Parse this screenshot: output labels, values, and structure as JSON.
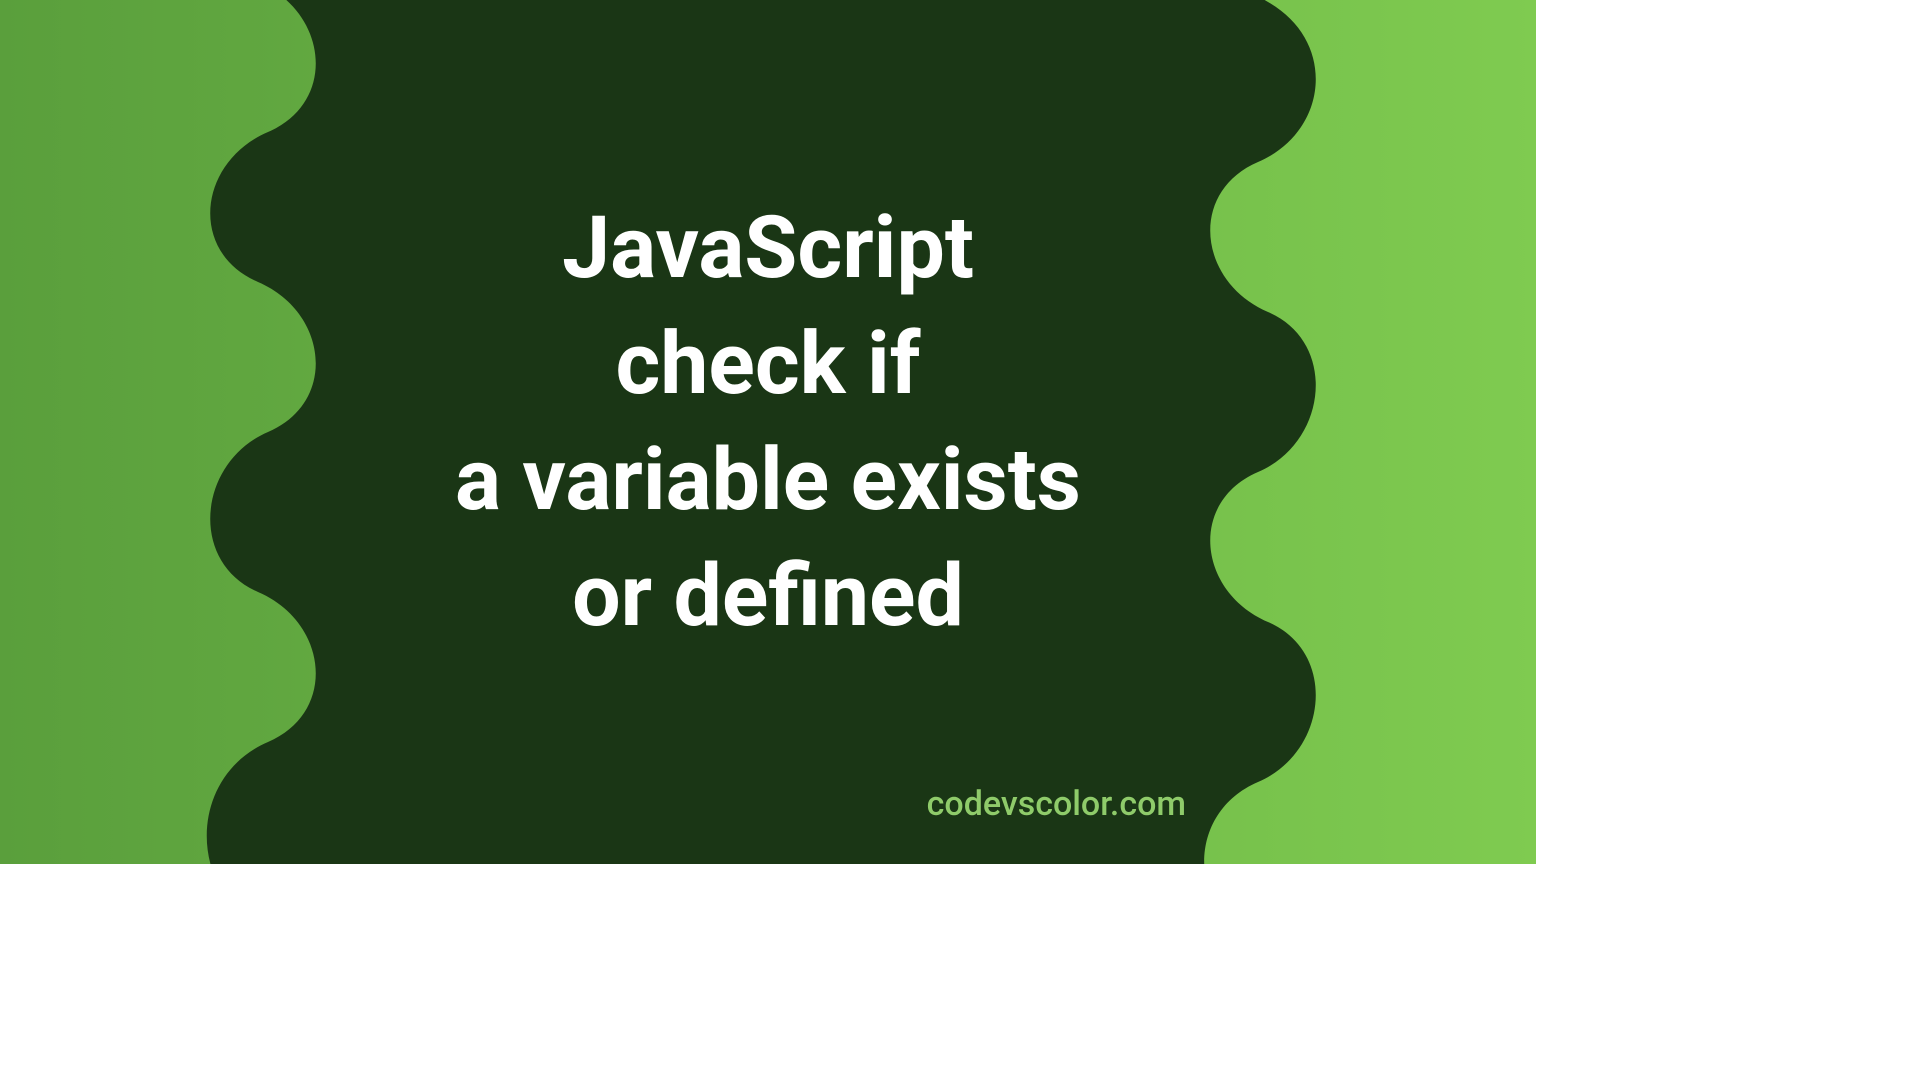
{
  "title_line1": "JavaScript",
  "title_line2": "check if",
  "title_line3": "a variable exists",
  "title_line4": "or defined",
  "site_name": "codevscolor.com",
  "colors": {
    "gradient_start": "#5a9f3c",
    "gradient_end": "#7fcb50",
    "blob": "#1a3615",
    "title_text": "#ffffff",
    "site_text": "#8fcb6a"
  }
}
